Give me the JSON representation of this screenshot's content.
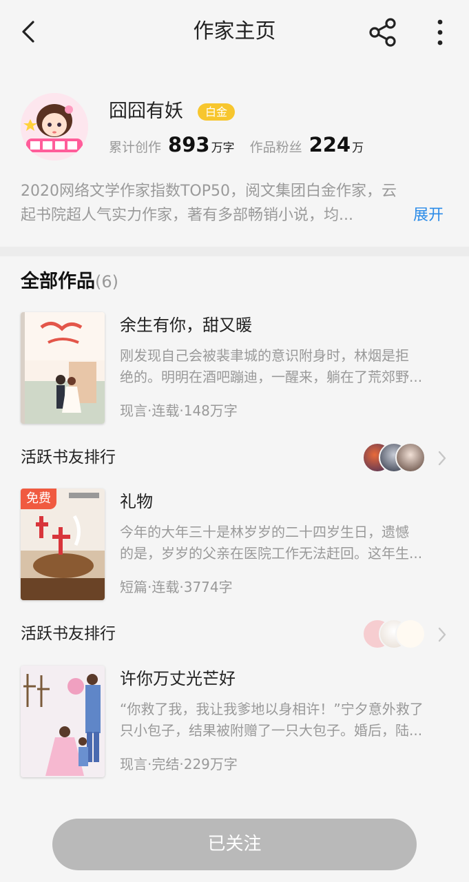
{
  "header": {
    "title": "作家主页",
    "back_icon": "chevron-left-icon",
    "share_icon": "share-icon",
    "more_icon": "more-vertical-icon"
  },
  "author": {
    "name": "囧囧有妖",
    "badge": "白金",
    "stats": [
      {
        "label": "累计创作",
        "value": "893",
        "unit": "万字"
      },
      {
        "label": "作品粉丝",
        "value": "224",
        "unit": "万"
      }
    ],
    "bio_lines": [
      "2020网络文学作家指数TOP50，阅文集团白金作家，云",
      "起书院超人气实力作家，著有多部畅销小说，均..."
    ],
    "expand_label": "展开"
  },
  "works": {
    "title": "全部作品",
    "count": "(6)",
    "books": [
      {
        "title": "余生有你，甜又暖",
        "desc_lines": [
          "刚发现自己会被裴聿城的意识附身时，林烟是拒",
          "绝的。明明在酒吧蹦迪，一醒来，躺在了荒郊野..."
        ],
        "meta": "现言·连载·148万字",
        "free_tag": ""
      },
      {
        "title": "礼物",
        "desc_lines": [
          "今年的大年三十是林岁岁的二十四岁生日，遗憾",
          "的是，岁岁的父亲在医院工作无法赶回。这年生..."
        ],
        "meta": "短篇·连载·3774字",
        "free_tag": "免费"
      },
      {
        "title": "许你万丈光芒好",
        "desc_lines": [
          "“你救了我，我让我爹地以身相许！”宁夕意外救了",
          "只小包子，结果被附赠了一只大包子。婚后，陆..."
        ],
        "meta": "现言·完结·229万字",
        "free_tag": ""
      }
    ],
    "rank_label": "活跃书友排行"
  },
  "follow_button": "已关注",
  "colors": {
    "accent_blue": "#2a8be8",
    "badge_gold": "#f7c62e",
    "free_red": "#f05a40",
    "button_gray": "#b9b9b9"
  }
}
